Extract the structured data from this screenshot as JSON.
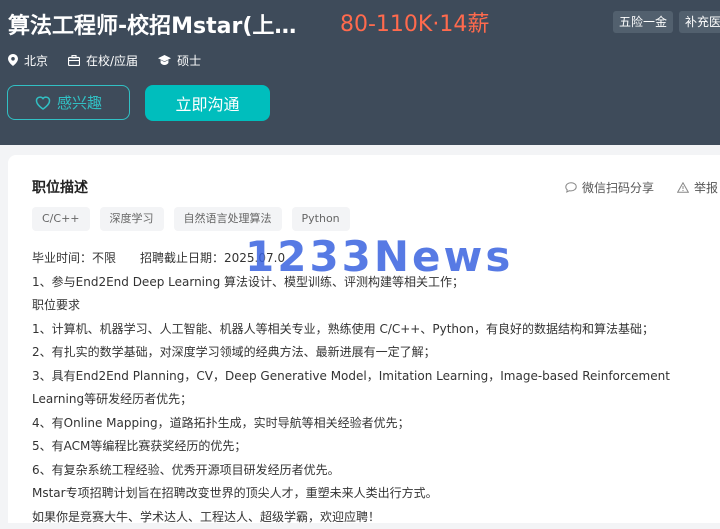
{
  "job": {
    "title": "算法工程师-校招Mstar(上…",
    "salary": "80-110K·14薪",
    "benefits": [
      "五险一金",
      "补充医"
    ],
    "meta": {
      "city": "北京",
      "status": "在校/应届",
      "degree": "硕士"
    }
  },
  "actions": {
    "interest_label": "感兴趣",
    "chat_label": "立即沟通"
  },
  "description": {
    "section_title": "职位描述",
    "share_label": "微信扫码分享",
    "report_label": "举报",
    "skills": [
      "C/C++",
      "深度学习",
      "自然语言处理算法",
      "Python"
    ],
    "lines": [
      "毕业时间：不限　　招聘截止日期：2025.07.0",
      "1、参与End2End Deep Learning 算法设计、模型训练、评测构建等相关工作；",
      "职位要求",
      "1、计算机、机器学习、人工智能、机器人等相关专业，熟练使用 C/C++、Python，有良好的数据结构和算法基础；",
      "2、有扎实的数学基础，对深度学习领域的经典方法、最新进展有一定了解；",
      "3、具有End2End Planning，CV，Deep Generative Model，Imitation Learning，Image-based Reinforcement Learning等研发经历者优先；",
      "4、有Online Mapping，道路拓扑生成，实时导航等相关经验者优先；",
      "5、有ACM等编程比赛获奖经历的优先；",
      "6、有复杂系统工程经验、优秀开源项目研发经历者优先。",
      "Mstar专项招聘计划旨在招聘改变世界的顶尖人才，重塑未来人类出行方式。",
      "如果你是竞赛大牛、学术达人、工程达人、超级学霸，欢迎应聘！"
    ]
  },
  "watermark": "1233News",
  "colors": {
    "header_bg": "#3e4b5a",
    "salary": "#ff6a4d",
    "accent": "#00bebd"
  }
}
